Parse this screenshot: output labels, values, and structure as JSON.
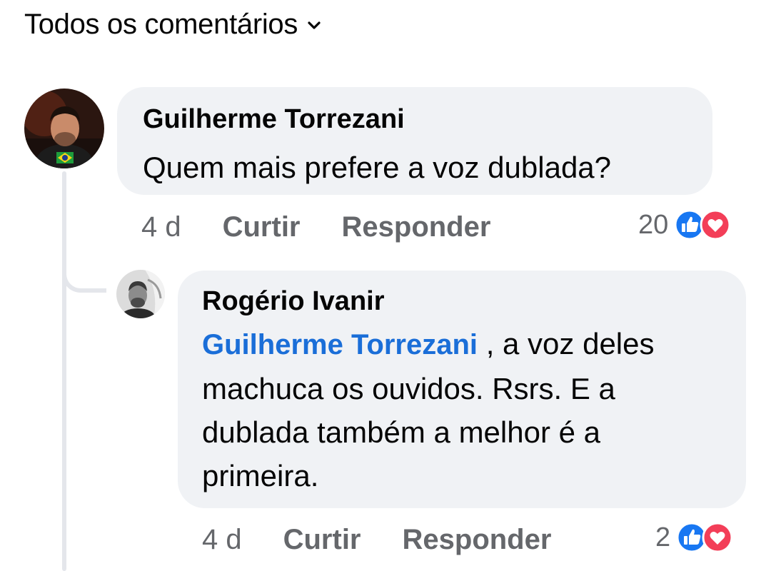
{
  "header": {
    "filter_label": "Todos os comentários",
    "filter_icon": "chevron-down-icon"
  },
  "comments": [
    {
      "author": "Guilherme Torrezani",
      "text": "Quem mais prefere a voz dublada?",
      "time": "4 d",
      "like_label": "Curtir",
      "reply_label": "Responder",
      "reaction_count": "20",
      "reactions": [
        "like-reaction-icon",
        "love-reaction-icon"
      ],
      "avatar_badge": "brazil-flag-icon"
    },
    {
      "author": "Rogério Ivanir",
      "mention": "Guilherme Torrezani",
      "text_after_mention": ", a voz deles machuca os ouvidos. Rsrs. E a dublada também a melhor é a primeira.",
      "time": "4 d",
      "like_label": "Curtir",
      "reply_label": "Responder",
      "reaction_count": "2",
      "reactions": [
        "like-reaction-icon",
        "love-reaction-icon"
      ]
    }
  ],
  "colors": {
    "bubble": "#f0f2f5",
    "thread_line": "#e4e6eb",
    "mention": "#1a6ed8",
    "secondary_text": "#65676b",
    "like": "#1877f2",
    "love": "#f33e58"
  }
}
